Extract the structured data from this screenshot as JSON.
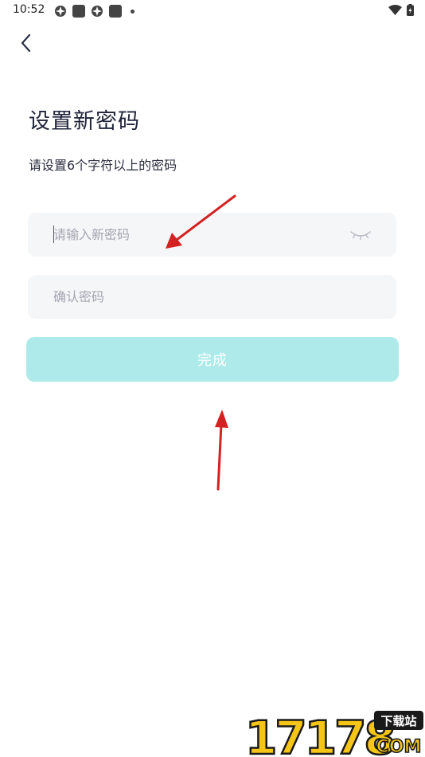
{
  "status_bar": {
    "time": "10:52"
  },
  "header": {
    "back_icon": "chevron-left-icon"
  },
  "title": "设置新密码",
  "subtitle": "请设置6个字符以上的密码",
  "form": {
    "new_password": {
      "placeholder": "请输入新密码",
      "value": "",
      "toggle_icon": "eye-closed-icon"
    },
    "confirm_password": {
      "placeholder": "确认密码",
      "value": ""
    },
    "submit_label": "完成"
  },
  "annotations": {
    "arrow_color": "#d42121"
  },
  "watermark": {
    "number": "17178",
    "tag": "下载站",
    "domain": "COM"
  },
  "colors": {
    "button_bg": "#aeeaea",
    "field_bg": "#f5f6f8",
    "title_text": "#20243a"
  }
}
